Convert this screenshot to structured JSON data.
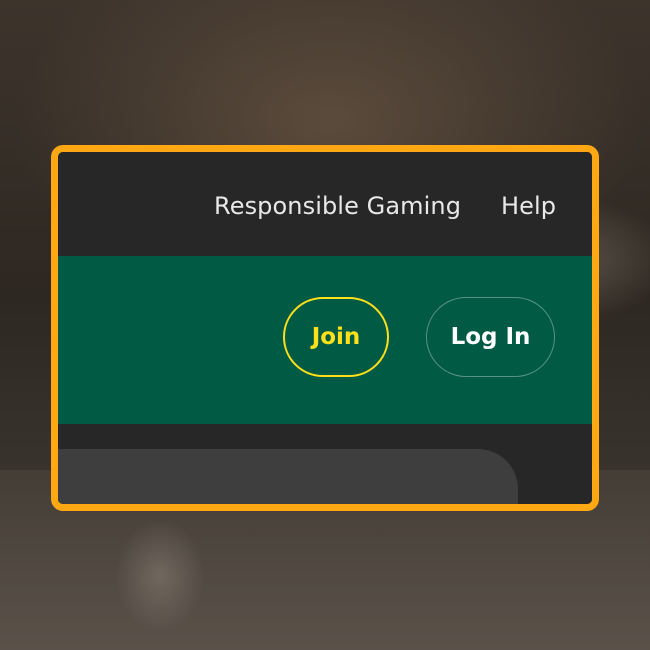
{
  "header": {
    "links": [
      {
        "label": "Responsible Gaming"
      },
      {
        "label": "Help"
      }
    ]
  },
  "auth": {
    "join_label": "Join",
    "login_label": "Log In"
  },
  "colors": {
    "highlight_frame": "#FFA814",
    "top_bar": "#272727",
    "green_bar": "#005A44",
    "join_accent": "#FFE01B"
  }
}
